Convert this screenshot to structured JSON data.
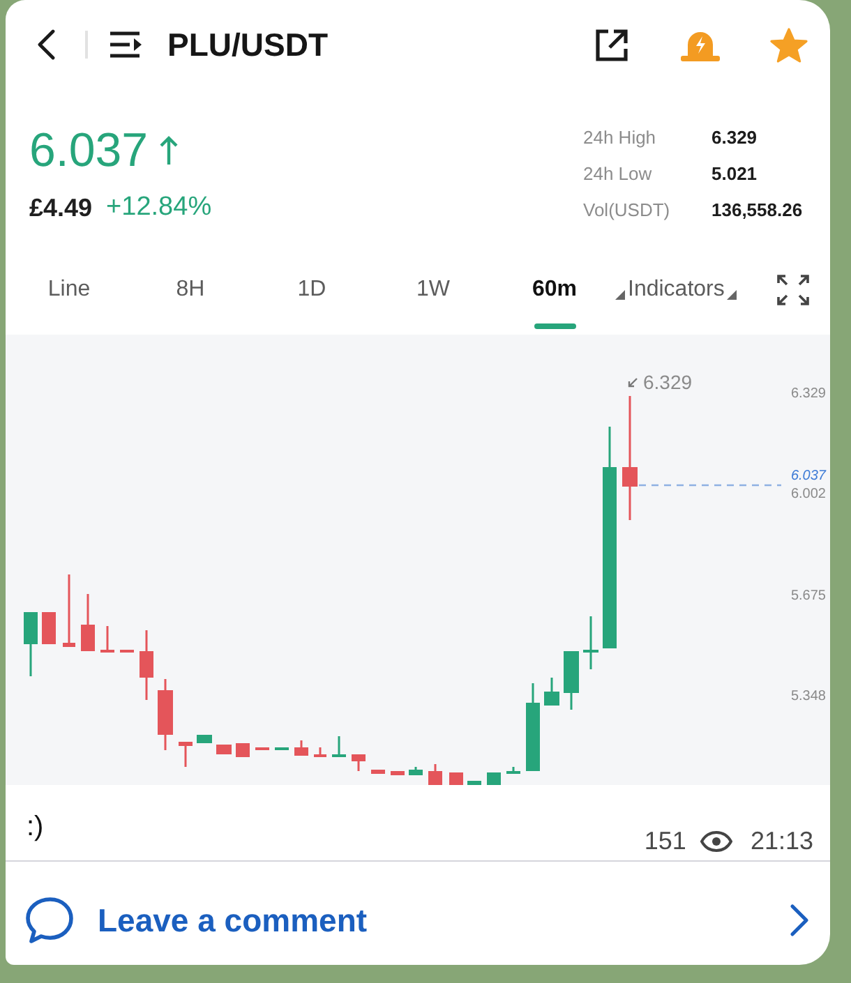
{
  "header": {
    "title": "PLU/USDT",
    "favorited": true
  },
  "ticker": {
    "last_price": "6.037",
    "rising": true,
    "fiat_price": "£4.49",
    "change": "+12.84%"
  },
  "stats": [
    {
      "label": "24h High",
      "value": "6.329"
    },
    {
      "label": "24h Low",
      "value": "5.021"
    },
    {
      "label": "Vol(USDT)",
      "value": "136,558.26"
    }
  ],
  "tabs": [
    {
      "label": "Line",
      "selected": false
    },
    {
      "label": "8H",
      "selected": false
    },
    {
      "label": "1D",
      "selected": false
    },
    {
      "label": "1W",
      "selected": false
    },
    {
      "label": "60m",
      "selected": true
    }
  ],
  "indicators_button": {
    "label": "Indicators"
  },
  "chart": {
    "high_marker": "6.329",
    "last_price_label": "6.037",
    "axis_labels": [
      "6.329",
      "6.002",
      "5.675",
      "5.348"
    ]
  },
  "message": {
    "caption": ":)",
    "views": "151",
    "time": "21:13"
  },
  "comment_link": {
    "label": "Leave a comment"
  }
}
